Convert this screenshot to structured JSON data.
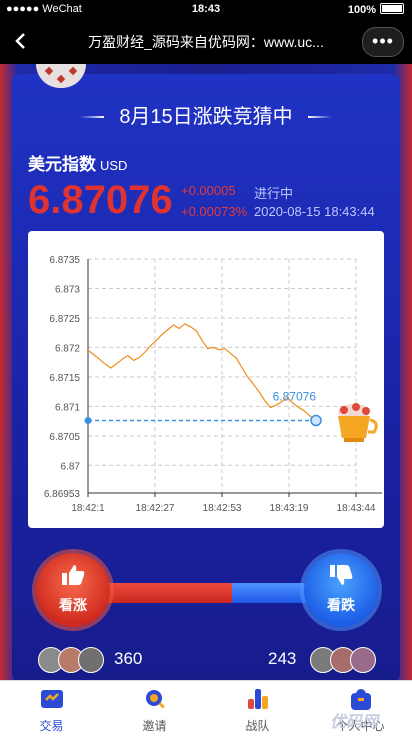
{
  "status_bar": {
    "carrier": "●●●●● WeChat",
    "time": "18:43",
    "battery": "100%"
  },
  "nav": {
    "back_icon": "chevron-left-icon",
    "title": "万盈财经_源码来自优码网：www.uc...",
    "more": "•••"
  },
  "banner": {
    "title": "8月15日涨跌竞猜中"
  },
  "index": {
    "name": "美元指数",
    "unit": "USD",
    "price": "6.87076",
    "change": "+0.00005",
    "change_pct": "+0.00073%",
    "status": "进行中",
    "datetime": "2020-08-15 18:43:44"
  },
  "chart_data": {
    "type": "line",
    "title": "",
    "xlabel": "",
    "ylabel": "",
    "x_ticks": [
      "18:42:1",
      "18:42:27",
      "18:42:53",
      "18:43:19",
      "18:43:44"
    ],
    "y_ticks": [
      "6.8735",
      "6.873",
      "6.8725",
      "6.872",
      "6.8715",
      "6.871",
      "6.8705",
      "6.87",
      "6.86953"
    ],
    "ylim": [
      6.86953,
      6.8735
    ],
    "reference_line": 6.87076,
    "last_value_label": "6.87076",
    "grid": true,
    "series": [
      {
        "color": "#f08c1a",
        "values": [
          6.87195,
          6.87188,
          6.8718,
          6.87172,
          6.87165,
          6.87172,
          6.8718,
          6.87186,
          6.87178,
          6.87183,
          6.87192,
          6.87203,
          6.87212,
          6.87222,
          6.8723,
          6.87238,
          6.87232,
          6.8724,
          6.87235,
          6.87228,
          6.87212,
          6.87198,
          6.872,
          6.87196,
          6.87198,
          6.8719,
          6.87182,
          6.87166,
          6.8715,
          6.87138,
          6.87125,
          6.8711,
          6.87098,
          6.87102,
          6.87108,
          6.87115,
          6.87105,
          6.87098,
          6.87092,
          6.87083,
          6.87076
        ]
      }
    ]
  },
  "prize": {
    "label": "包"
  },
  "bet": {
    "up_label": "看涨",
    "down_label": "看跌",
    "up_count": "360",
    "down_count": "243",
    "up_fraction": 0.6
  },
  "colors": {
    "up": "#e03331",
    "down": "#2b62e8",
    "accent": "#2b4ad6"
  },
  "tabs": [
    {
      "label": "交易",
      "icon": "trade-icon",
      "active": true
    },
    {
      "label": "邀请",
      "icon": "search-icon",
      "active": false
    },
    {
      "label": "战队",
      "icon": "team-chart-icon",
      "active": false
    },
    {
      "label": "个人中心",
      "icon": "user-icon",
      "active": false
    }
  ],
  "watermark": "优码网"
}
